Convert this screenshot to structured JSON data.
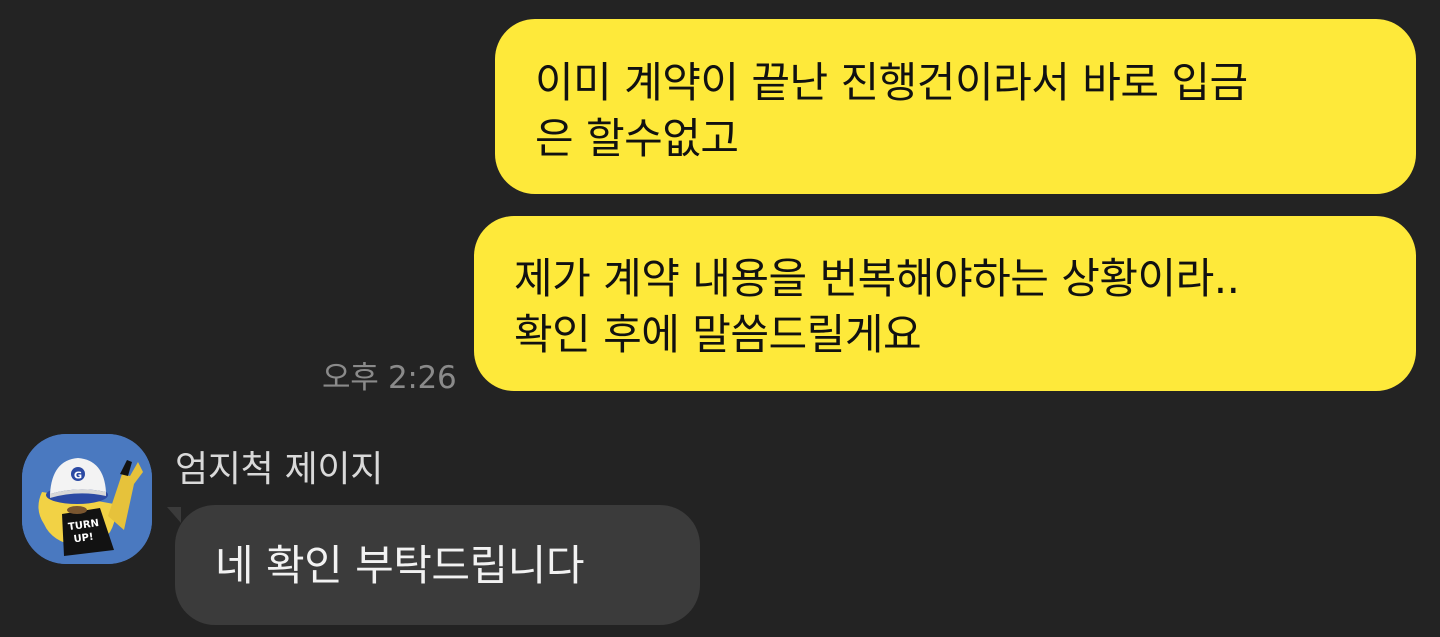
{
  "messages": {
    "outgoing_1": "이미 계약이 끝난 진행건이라서 바로 입금\n은 할수없고",
    "outgoing_2": "제가 계약 내용을 번복해야하는 상황이라..\n확인 후에 말씀드릴게요",
    "outgoing_time": "오후 2:26",
    "incoming_sender": "엄지척 제이지",
    "incoming_1": "네 확인 부탁드립니다",
    "incoming_avatar_text": "TURN UP!"
  },
  "colors": {
    "background": "#232323",
    "outgoing_bubble": "#fee93a",
    "incoming_bubble": "#3b3b3b",
    "avatar_bg": "#4a79c0"
  },
  "icons": {
    "avatar": "profile-character-avatar"
  }
}
